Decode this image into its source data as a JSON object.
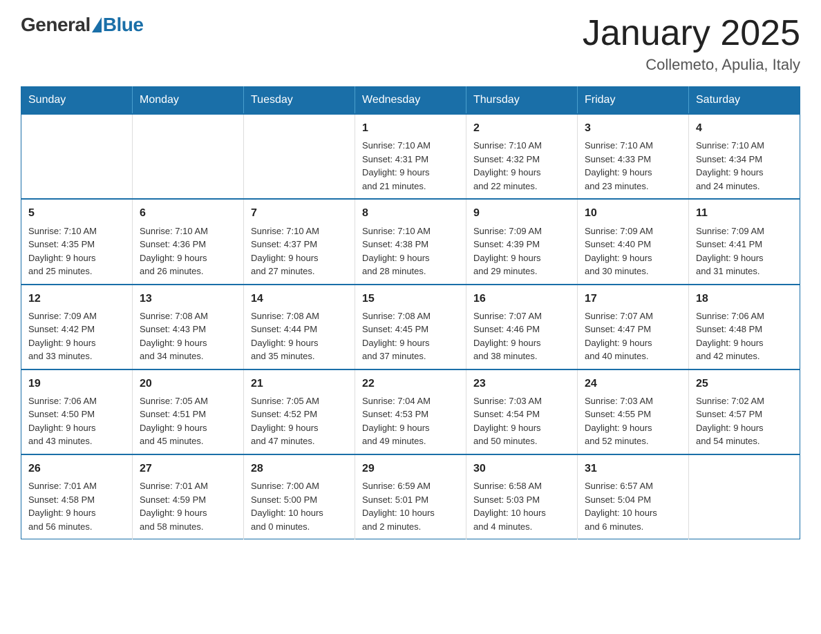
{
  "logo": {
    "general": "General",
    "blue": "Blue"
  },
  "title": "January 2025",
  "subtitle": "Collemeto, Apulia, Italy",
  "days_of_week": [
    "Sunday",
    "Monday",
    "Tuesday",
    "Wednesday",
    "Thursday",
    "Friday",
    "Saturday"
  ],
  "weeks": [
    [
      {
        "day": "",
        "info": ""
      },
      {
        "day": "",
        "info": ""
      },
      {
        "day": "",
        "info": ""
      },
      {
        "day": "1",
        "info": "Sunrise: 7:10 AM\nSunset: 4:31 PM\nDaylight: 9 hours\nand 21 minutes."
      },
      {
        "day": "2",
        "info": "Sunrise: 7:10 AM\nSunset: 4:32 PM\nDaylight: 9 hours\nand 22 minutes."
      },
      {
        "day": "3",
        "info": "Sunrise: 7:10 AM\nSunset: 4:33 PM\nDaylight: 9 hours\nand 23 minutes."
      },
      {
        "day": "4",
        "info": "Sunrise: 7:10 AM\nSunset: 4:34 PM\nDaylight: 9 hours\nand 24 minutes."
      }
    ],
    [
      {
        "day": "5",
        "info": "Sunrise: 7:10 AM\nSunset: 4:35 PM\nDaylight: 9 hours\nand 25 minutes."
      },
      {
        "day": "6",
        "info": "Sunrise: 7:10 AM\nSunset: 4:36 PM\nDaylight: 9 hours\nand 26 minutes."
      },
      {
        "day": "7",
        "info": "Sunrise: 7:10 AM\nSunset: 4:37 PM\nDaylight: 9 hours\nand 27 minutes."
      },
      {
        "day": "8",
        "info": "Sunrise: 7:10 AM\nSunset: 4:38 PM\nDaylight: 9 hours\nand 28 minutes."
      },
      {
        "day": "9",
        "info": "Sunrise: 7:09 AM\nSunset: 4:39 PM\nDaylight: 9 hours\nand 29 minutes."
      },
      {
        "day": "10",
        "info": "Sunrise: 7:09 AM\nSunset: 4:40 PM\nDaylight: 9 hours\nand 30 minutes."
      },
      {
        "day": "11",
        "info": "Sunrise: 7:09 AM\nSunset: 4:41 PM\nDaylight: 9 hours\nand 31 minutes."
      }
    ],
    [
      {
        "day": "12",
        "info": "Sunrise: 7:09 AM\nSunset: 4:42 PM\nDaylight: 9 hours\nand 33 minutes."
      },
      {
        "day": "13",
        "info": "Sunrise: 7:08 AM\nSunset: 4:43 PM\nDaylight: 9 hours\nand 34 minutes."
      },
      {
        "day": "14",
        "info": "Sunrise: 7:08 AM\nSunset: 4:44 PM\nDaylight: 9 hours\nand 35 minutes."
      },
      {
        "day": "15",
        "info": "Sunrise: 7:08 AM\nSunset: 4:45 PM\nDaylight: 9 hours\nand 37 minutes."
      },
      {
        "day": "16",
        "info": "Sunrise: 7:07 AM\nSunset: 4:46 PM\nDaylight: 9 hours\nand 38 minutes."
      },
      {
        "day": "17",
        "info": "Sunrise: 7:07 AM\nSunset: 4:47 PM\nDaylight: 9 hours\nand 40 minutes."
      },
      {
        "day": "18",
        "info": "Sunrise: 7:06 AM\nSunset: 4:48 PM\nDaylight: 9 hours\nand 42 minutes."
      }
    ],
    [
      {
        "day": "19",
        "info": "Sunrise: 7:06 AM\nSunset: 4:50 PM\nDaylight: 9 hours\nand 43 minutes."
      },
      {
        "day": "20",
        "info": "Sunrise: 7:05 AM\nSunset: 4:51 PM\nDaylight: 9 hours\nand 45 minutes."
      },
      {
        "day": "21",
        "info": "Sunrise: 7:05 AM\nSunset: 4:52 PM\nDaylight: 9 hours\nand 47 minutes."
      },
      {
        "day": "22",
        "info": "Sunrise: 7:04 AM\nSunset: 4:53 PM\nDaylight: 9 hours\nand 49 minutes."
      },
      {
        "day": "23",
        "info": "Sunrise: 7:03 AM\nSunset: 4:54 PM\nDaylight: 9 hours\nand 50 minutes."
      },
      {
        "day": "24",
        "info": "Sunrise: 7:03 AM\nSunset: 4:55 PM\nDaylight: 9 hours\nand 52 minutes."
      },
      {
        "day": "25",
        "info": "Sunrise: 7:02 AM\nSunset: 4:57 PM\nDaylight: 9 hours\nand 54 minutes."
      }
    ],
    [
      {
        "day": "26",
        "info": "Sunrise: 7:01 AM\nSunset: 4:58 PM\nDaylight: 9 hours\nand 56 minutes."
      },
      {
        "day": "27",
        "info": "Sunrise: 7:01 AM\nSunset: 4:59 PM\nDaylight: 9 hours\nand 58 minutes."
      },
      {
        "day": "28",
        "info": "Sunrise: 7:00 AM\nSunset: 5:00 PM\nDaylight: 10 hours\nand 0 minutes."
      },
      {
        "day": "29",
        "info": "Sunrise: 6:59 AM\nSunset: 5:01 PM\nDaylight: 10 hours\nand 2 minutes."
      },
      {
        "day": "30",
        "info": "Sunrise: 6:58 AM\nSunset: 5:03 PM\nDaylight: 10 hours\nand 4 minutes."
      },
      {
        "day": "31",
        "info": "Sunrise: 6:57 AM\nSunset: 5:04 PM\nDaylight: 10 hours\nand 6 minutes."
      },
      {
        "day": "",
        "info": ""
      }
    ]
  ]
}
